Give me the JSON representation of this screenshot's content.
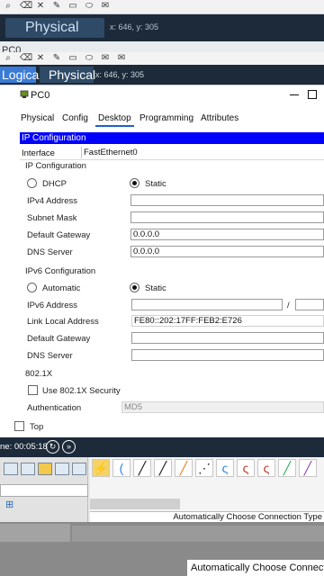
{
  "ghost": {
    "physical_label": "Physical",
    "coords": "x: 646, y: 305",
    "pc0": "PC0"
  },
  "workspace_bar": {
    "logical": "Logical",
    "physical": "Physical",
    "coords": "x: 646, y: 305"
  },
  "dialog": {
    "title": "PC0",
    "tabs": [
      "Physical",
      "Config",
      "Desktop",
      "Programming",
      "Attributes"
    ],
    "active_tab": "Desktop",
    "ip_configuration_header": "IP Configuration",
    "interface_label": "Interface",
    "interface_value": "FastEthernet0",
    "ipv4": {
      "section": "IP Configuration",
      "dhcp_label": "DHCP",
      "static_label": "Static",
      "address_label": "IPv4 Address",
      "address_value": "",
      "subnet_label": "Subnet Mask",
      "subnet_value": "",
      "gateway_label": "Default Gateway",
      "gateway_value": "0.0.0.0",
      "dns_label": "DNS Server",
      "dns_value": "0.0.0.0"
    },
    "ipv6": {
      "section": "IPv6 Configuration",
      "auto_label": "Automatic",
      "static_label": "Static",
      "address_label": "IPv6 Address",
      "address_value": "",
      "slash": "/",
      "link_local_label": "Link Local Address",
      "link_local_value": "FE80::202:17FF:FEB2:E726",
      "gateway_label": "Default Gateway",
      "gateway_value": "",
      "dns_label": "DNS Server",
      "dns_value": ""
    },
    "dot1x": {
      "section": "802.1X",
      "use_label": "Use 802.1X Security",
      "auth_label": "Authentication",
      "auth_value": "MD5"
    },
    "top_label": "Top"
  },
  "sim": {
    "time": "ne: 00:05:18"
  },
  "status": {
    "connection_hint": "Automatically Choose Connection Type",
    "connection_hint_ghost": "Automatically Choose Connect"
  }
}
